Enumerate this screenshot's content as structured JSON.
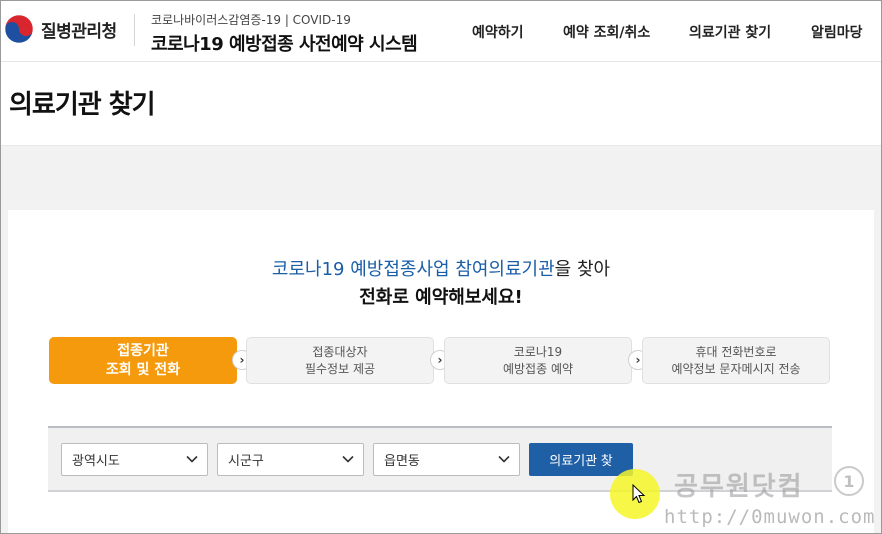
{
  "header": {
    "agency_name": "질병관리청",
    "system_subtitle": "코로나바이러스감염증-19 | COVID-19",
    "system_title": "코로나19 예방접종 사전예약 시스템",
    "nav": [
      "예약하기",
      "예약 조회/취소",
      "의료기관 찾기",
      "알림마당"
    ]
  },
  "page_title": "의료기관 찾기",
  "intro": {
    "line1_part1": "코로나19 예방접종사업 ",
    "line1_highlight": "참여의료기관",
    "line1_part2": "을 찾아",
    "line2": "전화로 예약해보세요!"
  },
  "steps": [
    {
      "line1": "접종기관",
      "line2": "조회 및 전화",
      "active": true
    },
    {
      "line1": "접종대상자",
      "line2": "필수정보 제공",
      "active": false
    },
    {
      "line1": "코로나19",
      "line2": "예방접종 예약",
      "active": false
    },
    {
      "line1": "휴대 전화번호로",
      "line2": "예약정보 문자메시지 전송",
      "active": false
    }
  ],
  "search": {
    "province": "광역시도",
    "district": "시군구",
    "town": "읍면동",
    "button_label": "의료기관 찾"
  },
  "watermark": {
    "text": "공무원닷컴",
    "badge": "1",
    "url": "http://0muwon.com"
  },
  "colors": {
    "accent_orange": "#f59a0c",
    "primary_blue": "#1f5fa6",
    "highlight_blue": "#1a5ea8"
  }
}
